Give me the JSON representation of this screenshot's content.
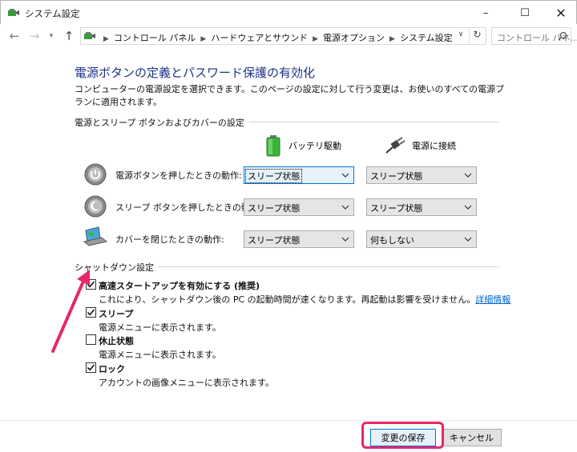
{
  "window": {
    "title": "システム設定",
    "controls": {
      "minimize": "–",
      "maximize": "☐",
      "close": "✕"
    }
  },
  "nav": {
    "breadcrumbs": [
      "コントロール パネル",
      "ハードウェアとサウンド",
      "電源オプション",
      "システム設定"
    ],
    "search_placeholder": "コントロール パネ..."
  },
  "page": {
    "heading": "電源ボタンの定義とパスワード保護の有効化",
    "description": "コンピューターの電源設定を選択できます。このページの設定に対して行う変更は、お使いのすべての電源プランに適用されます。"
  },
  "power_section": {
    "label": "電源とスリープ ボタンおよびカバーの設定",
    "columns": {
      "battery": "バッテリ駆動",
      "plugged": "電源に接続"
    },
    "rows": [
      {
        "label": "電源ボタンを押したときの動作:",
        "battery": "スリープ状態",
        "plugged": "スリープ状態"
      },
      {
        "label": "スリープ ボタンを押したときの動作:",
        "battery": "スリープ状態",
        "plugged": "スリープ状態"
      },
      {
        "label": "カバーを閉じたときの動作:",
        "battery": "スリープ状態",
        "plugged": "何もしない"
      }
    ]
  },
  "shutdown_section": {
    "label": "シャットダウン設定",
    "items": [
      {
        "title": "高速スタートアップを有効にする (推奨)",
        "desc": "これにより、シャットダウン後の PC の起動時間が速くなります。再起動は影響を受けません。",
        "link": "詳細情報",
        "checked": true
      },
      {
        "title": "スリープ",
        "desc": "電源メニューに表示されます。",
        "checked": true
      },
      {
        "title": "休止状態",
        "desc": "電源メニューに表示されます。",
        "checked": false
      },
      {
        "title": "ロック",
        "desc": "アカウントの画像メニューに表示されます。",
        "checked": true
      }
    ]
  },
  "footer": {
    "save": "変更の保存",
    "cancel": "キャンセル"
  },
  "colors": {
    "heading": "#1e3287",
    "link": "#0066cc",
    "highlight": "#e8266c",
    "focus": "#0078d7"
  }
}
